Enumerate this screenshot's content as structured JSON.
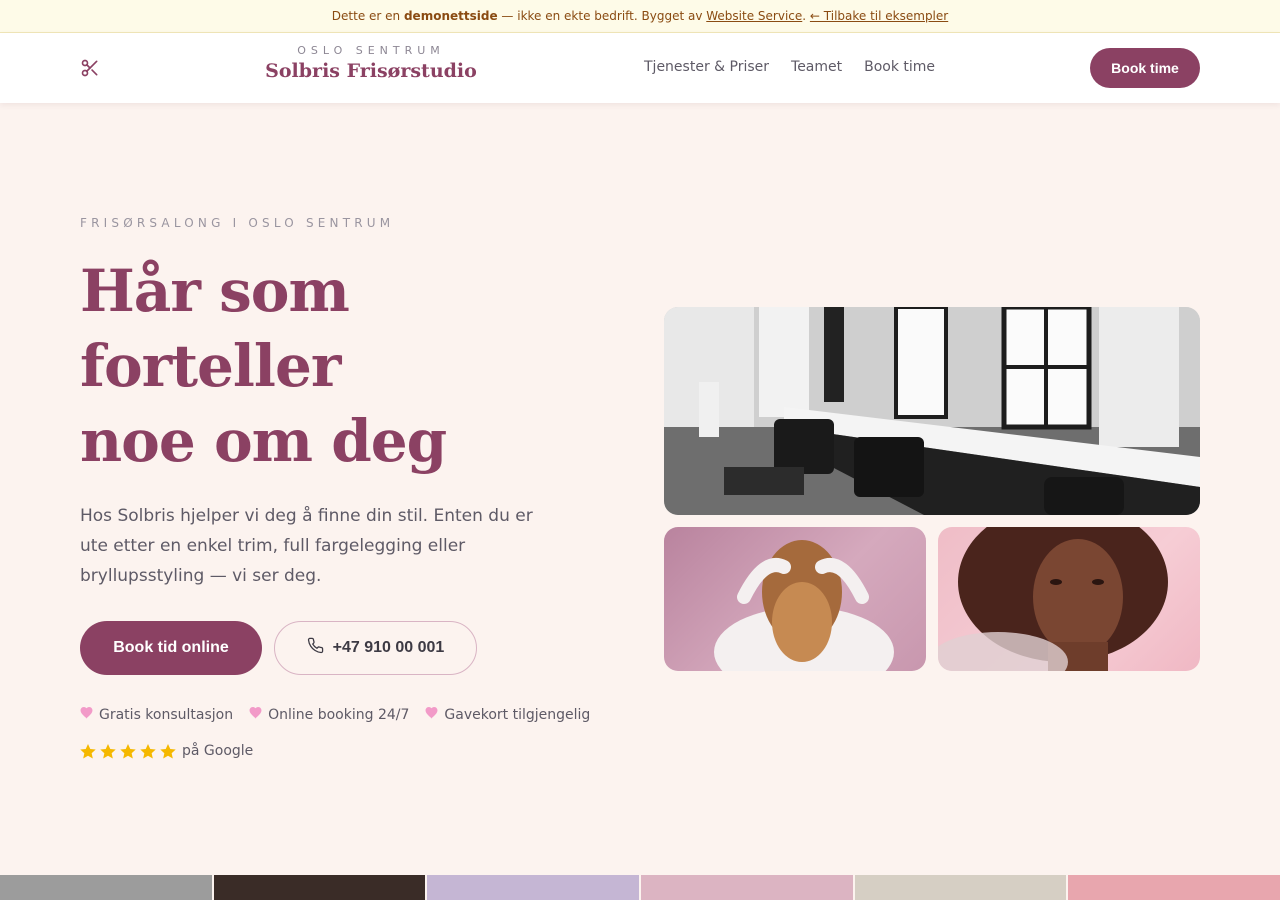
{
  "banner": {
    "prefix": "Dette er en",
    "bold": "demonettside",
    "middle": "— ikke en ekte bedrift. Bygget av",
    "link": "Website Service",
    "back_link": "← Tilbake til eksempler"
  },
  "header": {
    "logo_icon": "scissors-icon",
    "brand_sub": "OSLO SENTRUM",
    "brand_name": "Solbris Frisørstudio",
    "nav": [
      "Tjenester & Priser",
      "Teamet",
      "Book time"
    ],
    "cta": "Book time"
  },
  "hero": {
    "eyebrow": "FRISØRSALONG I OSLO SENTRUM",
    "title_lines": [
      "Hår som",
      "forteller",
      "noe om deg"
    ],
    "text": "Hos Solbris hjelper vi deg å finne din stil. Enten du er ute etter en enkel trim, full fargelegging eller bryllupsstyling — vi ser deg.",
    "primary_button": "Book tid online",
    "phone_icon": "phone-icon",
    "phone_button": "+47 910 00 001",
    "features": [
      {
        "icon": "heart-icon",
        "label": "Gratis konsultasjon"
      },
      {
        "icon": "heart-icon",
        "label": "Online booking 24/7"
      },
      {
        "icon": "heart-icon",
        "label": "Gavekort tilgjengelig"
      }
    ],
    "rating": {
      "stars": 5,
      "max": 5,
      "label": "på Google"
    }
  },
  "colors": {
    "brand": "#8b4163",
    "background": "#fcf3ef",
    "heart": "#f29ac8",
    "star": "#f5b800"
  }
}
